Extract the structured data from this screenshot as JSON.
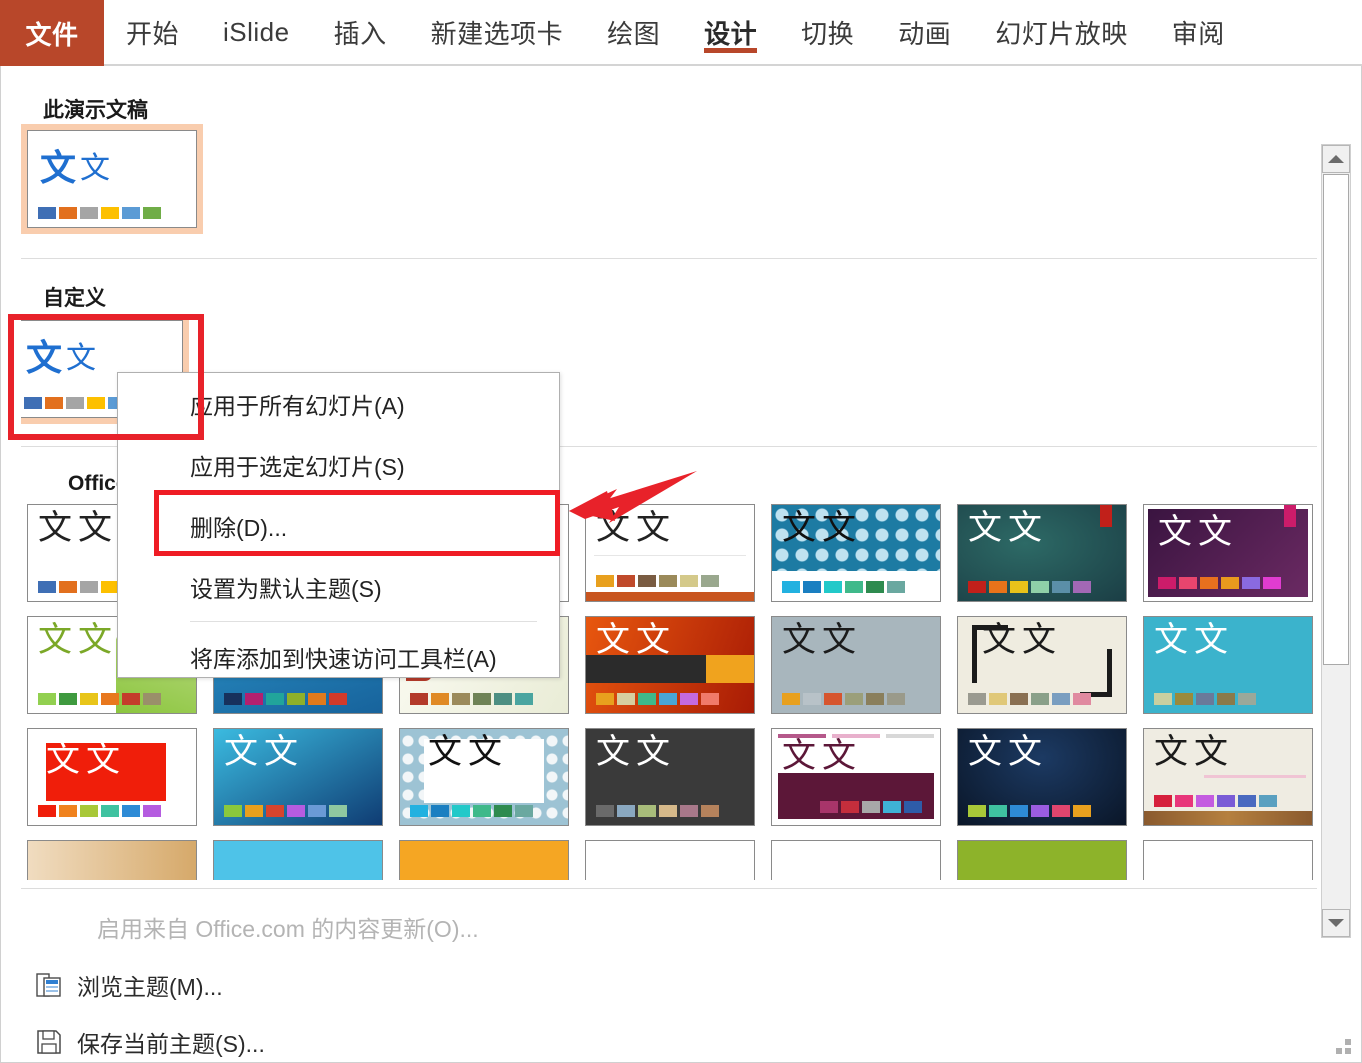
{
  "ribbon": {
    "tabs": [
      {
        "label": "文件",
        "kind": "file"
      },
      {
        "label": "开始",
        "kind": "normal"
      },
      {
        "label": "iSlide",
        "kind": "normal"
      },
      {
        "label": "插入",
        "kind": "normal"
      },
      {
        "label": "新建选项卡",
        "kind": "normal"
      },
      {
        "label": "绘图",
        "kind": "normal"
      },
      {
        "label": "设计",
        "kind": "active"
      },
      {
        "label": "切换",
        "kind": "normal"
      },
      {
        "label": "动画",
        "kind": "normal"
      },
      {
        "label": "幻灯片放映",
        "kind": "normal"
      },
      {
        "label": "审阅",
        "kind": "normal"
      }
    ],
    "active_tab": "设计",
    "file_tab_color": "#b8472a",
    "active_underline_color": "#b8472a"
  },
  "gallery": {
    "sections": [
      {
        "title": "此演示文稿"
      },
      {
        "title": "自定义"
      },
      {
        "title": "Office"
      }
    ],
    "this_presentation_theme": {
      "glyph_big": "文",
      "glyph_small": "文",
      "accent": "#1f6fd0",
      "swatches": [
        "#3f6fb5",
        "#e2701e",
        "#a5a5a5",
        "#fdc000",
        "#5b9bd5",
        "#70ad47"
      ]
    },
    "custom_theme": {
      "glyph_big": "文",
      "glyph_small": "文",
      "accent": "#1f6fd0",
      "swatches": [
        "#3f6fb5",
        "#e2701e",
        "#a5a5a5",
        "#fdc000",
        "#5b9bd5",
        "#70ad47"
      ]
    },
    "office_themes": [
      {
        "name": "office-theme",
        "bg": "#ffffff",
        "text": "#222222",
        "swatches": [
          "#3f6fb5",
          "#e2701e",
          "#a5a5a5",
          "#fdc000",
          "#5b9bd5",
          "#70ad47"
        ]
      },
      {
        "name": "facet-theme",
        "bg": "#ffffff",
        "text": "#222222",
        "swatches": [
          "#92d050",
          "#4a9b3f",
          "#e8c51a",
          "#e8781e",
          "#c43c2b",
          "#9a8f6a"
        ]
      },
      {
        "name": "integral-theme",
        "bg": "#ffffff",
        "text": "#222222",
        "swatches": [
          "#1f4e79",
          "#b3206f",
          "#21a49b",
          "#8eb02a",
          "#e07a1c",
          "#d13a2a"
        ]
      },
      {
        "name": "ion-boardroom-theme",
        "bg": "#f5f3e6",
        "text": "#222222",
        "swatches": [
          "#b33a2a",
          "#e08a25",
          "#9b8a5a",
          "#6f8356",
          "#4d8f82",
          "#4aa5a0"
        ]
      },
      {
        "name": "ion-theme",
        "bg": "#ffffff",
        "text": "#222222",
        "swatches": [
          "#e8a01e",
          "#c04a2b",
          "#7a5c42",
          "#9b8a5a",
          "#d4c98a",
          "#9aa88e"
        ]
      },
      {
        "name": "retrospect-theme",
        "bg": "#1d7ba3",
        "text": "#1b1b1b",
        "swatches": [
          "#22b1e0",
          "#1a7fc1",
          "#22c9c9",
          "#3fb98a",
          "#2e8b4f",
          "#6aa8a0"
        ]
      },
      {
        "name": "slice-theme",
        "bg": "#20464a",
        "text": "#ffffff",
        "swatches": [
          "#c1201a",
          "#e8731a",
          "#e8c21a",
          "#8fd0a8",
          "#5b8fa8",
          "#a268b5"
        ]
      },
      {
        "name": "wisp-theme",
        "bg": "#4a2150",
        "text": "#ffffff",
        "swatches": [
          "#cc1c6a",
          "#e8456e",
          "#e8701e",
          "#e89a1e",
          "#8a6ae0",
          "#e03cd0"
        ]
      },
      {
        "name": "banded-theme",
        "bg": "#ffffff",
        "text": "#7ba828",
        "swatches": [
          "#92d050",
          "#3f9a3f",
          "#e8c51a",
          "#e8781e",
          "#c43c2b",
          "#9a8f6a"
        ]
      },
      {
        "name": "basis-theme",
        "bg": "#1a6ba3",
        "text": "#ffffff",
        "swatches": [
          "#17315c",
          "#b3206f",
          "#21a49b",
          "#8eb02a",
          "#e07a1c",
          "#d13a2a"
        ]
      },
      {
        "name": "berlin-theme",
        "bg": "#f2f3e2",
        "text": "#222222",
        "swatches": [
          "#b33a2a",
          "#e08a25",
          "#9b8a5a",
          "#6f8356",
          "#4d8f82",
          "#4aa5a0"
        ]
      },
      {
        "name": "celestial-theme",
        "bg": "#c84a10",
        "text": "#ffffff",
        "swatches": [
          "#e8a01e",
          "#d6cfa0",
          "#3fb98a",
          "#4aa5d6",
          "#c46ae0",
          "#f07a6a"
        ]
      },
      {
        "name": "circuit-theme",
        "bg": "#a8b6bd",
        "text": "#222222",
        "swatches": [
          "#e8a01e",
          "#c8c8c8",
          "#d6552e",
          "#9b9f7a",
          "#8a7f5c",
          "#9a9a8a"
        ]
      },
      {
        "name": "damask-theme",
        "bg": "#efece0",
        "text": "#1b1b1b",
        "swatches": [
          "#9a9a90",
          "#e0c878",
          "#8a7052",
          "#8aa089",
          "#7a9ec0",
          "#e08aa0"
        ]
      },
      {
        "name": "depth-theme",
        "bg": "#3bb3cc",
        "text": "#ffffff",
        "swatches": [
          "#c8cfa0",
          "#9a8a3c",
          "#6a7a9a",
          "#8a7a4a",
          "#9aa89a",
          "#b5b59a"
        ]
      },
      {
        "name": "dividend-theme",
        "bg": "#ffffff",
        "text": "#ffffff",
        "swatches": [
          "#f01e0a",
          "#f0821e",
          "#a8c838",
          "#3fc2a0",
          "#2e8bd6",
          "#b55ce0"
        ]
      },
      {
        "name": "droplet-theme",
        "bg": "#1a6fa8",
        "text": "#ffffff",
        "swatches": [
          "#8ac83c",
          "#e8a01e",
          "#d6442e",
          "#b55ce0",
          "#6a9ad6",
          "#8fc8a0"
        ]
      },
      {
        "name": "facet2-theme",
        "bg": "#8fb8cc",
        "text": "#1b1b1b",
        "swatches": [
          "#22b1e0",
          "#1a7fc1",
          "#22c9c9",
          "#3fb98a",
          "#2e8b4f",
          "#6aa8a0"
        ]
      },
      {
        "name": "feathered-theme",
        "bg": "#3a3a3a",
        "text": "#ffffff",
        "swatches": [
          "#6a6a6a",
          "#8aa8c0",
          "#a8bc7a",
          "#d6b98a",
          "#a8788a",
          "#b5825c"
        ]
      },
      {
        "name": "frame-theme",
        "bg": "#ffffff",
        "text": "#5c1738",
        "swatches": [
          "#a8356a",
          "#c42e3c",
          "#a8a8a8",
          "#3fb2d6",
          "#2e5ca8",
          "#6a6a9a"
        ]
      },
      {
        "name": "gallery-theme",
        "bg": "#10233f",
        "text": "#ffffff",
        "swatches": [
          "#a8c838",
          "#3fc2a0",
          "#2e8bd6",
          "#9a5ce0",
          "#e0456e",
          "#e8a01e"
        ]
      },
      {
        "name": "headlines-theme",
        "bg": "#efece2",
        "text": "#1b1b1b",
        "swatches": [
          "#d6203c",
          "#e8367a",
          "#c45ce0",
          "#7a5cd6",
          "#4a6ac0",
          "#5aa0c0"
        ]
      },
      {
        "name": "partial-row4-a",
        "bg": "#e8c89a",
        "text": "#222222",
        "swatches": []
      },
      {
        "name": "partial-row4-b",
        "bg": "#4ec3e8",
        "text": "#222222",
        "swatches": []
      },
      {
        "name": "partial-row4-c",
        "bg": "#f5a623",
        "text": "#222222",
        "swatches": []
      },
      {
        "name": "partial-row4-d",
        "bg": "#ffffff",
        "text": "#222222",
        "swatches": []
      },
      {
        "name": "partial-row4-e",
        "bg": "#ffffff",
        "text": "#222222",
        "swatches": []
      },
      {
        "name": "partial-row4-f",
        "bg": "#8db32a",
        "text": "#222222",
        "swatches": []
      },
      {
        "name": "partial-row4-g",
        "bg": "#ffffff",
        "text": "#222222",
        "swatches": []
      }
    ],
    "theme_glyphs": "文文"
  },
  "context_menu": {
    "items": [
      {
        "label": "应用于所有幻灯片(A)",
        "accel": "A",
        "separator_after": false,
        "highlighted": false
      },
      {
        "label": "应用于选定幻灯片(S)",
        "accel": "S",
        "separator_after": false,
        "highlighted": false
      },
      {
        "label": "删除(D)...",
        "accel": "D",
        "separator_after": false,
        "highlighted": true
      },
      {
        "label": "设置为默认主题(S)",
        "accel": "S",
        "separator_after": true,
        "highlighted": false
      },
      {
        "label": "将库添加到快速访问工具栏(A)",
        "accel": "A",
        "separator_after": false,
        "highlighted": false
      }
    ]
  },
  "bottom_commands": [
    {
      "label": "启用来自 Office.com 的内容更新(O)...",
      "icon": "none",
      "disabled": true
    },
    {
      "label": "浏览主题(M)...",
      "icon": "browse-theme-icon",
      "disabled": false
    },
    {
      "label": "保存当前主题(S)...",
      "icon": "save-theme-icon",
      "disabled": false
    }
  ],
  "annotations": {
    "red_highlight_color": "#ef1c24",
    "arrow_color": "#e8222a",
    "selection_fill": "#f9cdae"
  },
  "scrollbar": {
    "up_arrow": "▲",
    "down_arrow": "▼"
  }
}
